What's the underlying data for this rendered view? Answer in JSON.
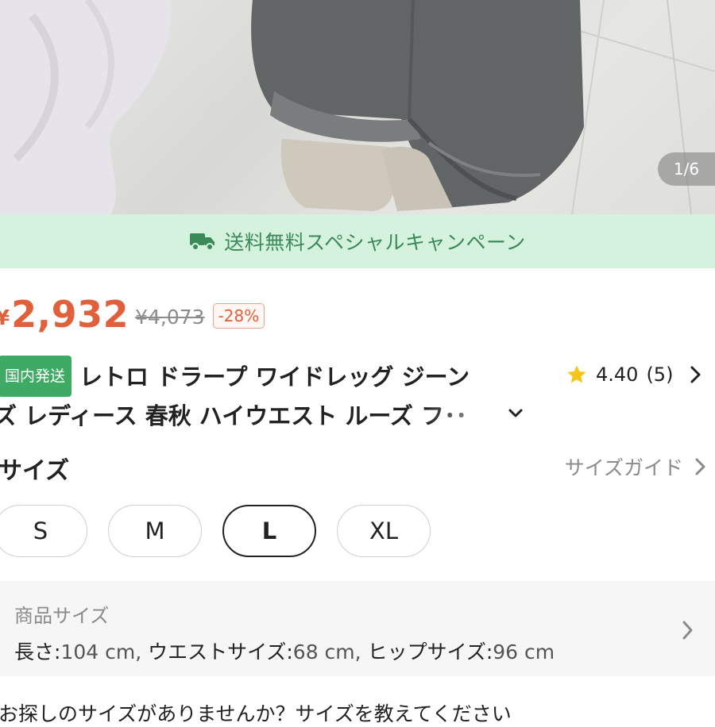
{
  "image_counter": "1/6",
  "banner": {
    "text": "送料無料スペシャルキャンペーン",
    "icon": "truck-icon",
    "color": "#3a8b57",
    "background": "#d5f2df"
  },
  "price": {
    "currency": "¥",
    "current": "2,932",
    "original": "¥4,073",
    "discount": "-28%",
    "color": "#e0603c"
  },
  "product": {
    "badge": "国内発送",
    "title_line1": "レトロ ドラープ ワイドレッグ ジーン",
    "title_line2": "ズ レディース 春秋 ハイウエスト ルーズ フ･･"
  },
  "rating": {
    "score": "4.40",
    "count": "(5)",
    "icon": "star-icon"
  },
  "size": {
    "label": "サイズ",
    "guide_label": "サイズガイド",
    "options": [
      "S",
      "M",
      "L",
      "XL"
    ],
    "selected": "L"
  },
  "spec": {
    "title": "商品サイズ",
    "length_label": "長さ:",
    "length_value": "104 cm,",
    "waist_label": "ウエストサイズ:",
    "waist_value": "68 cm,",
    "hip_label": "ヒップサイズ:",
    "hip_value": "96 cm"
  },
  "footer_partial": "お探しのサイズがありませんか？サイズを教えてください"
}
